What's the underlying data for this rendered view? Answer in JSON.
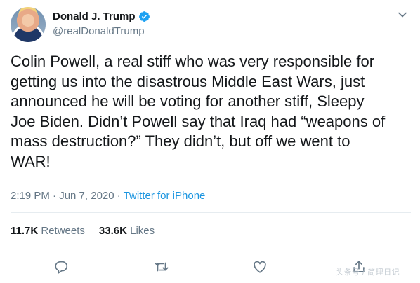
{
  "author": {
    "display_name": "Donald J. Trump",
    "handle": "@realDonaldTrump",
    "verified": true
  },
  "tweet": {
    "text": "Colin Powell, a real stiff who was very responsible for\ngetting us into the disastrous Middle East Wars, just\nannounced he will be voting for another stiff, Sleepy\nJoe Biden. Didn’t Powell say that Iraq had “weapons of\nmass destruction?” They didn’t, but off we went to\nWAR!",
    "time": "2:19 PM · Jun 7, 2020 · ",
    "source": "Twitter for iPhone"
  },
  "stats": {
    "retweets_count": "11.7K",
    "retweets_label": "Retweets",
    "likes_count": "33.6K",
    "likes_label": "Likes"
  },
  "icons": {
    "verified": "verified-badge-icon",
    "caret": "chevron-down-icon",
    "reply": "reply-icon",
    "retweet": "retweet-icon",
    "like": "heart-icon",
    "share": "share-icon"
  },
  "colors": {
    "text": "#14171a",
    "secondary": "#657786",
    "link": "#1b95e0",
    "verified": "#1da1f2"
  },
  "watermark": {
    "text": "头条号 / 简理日记"
  }
}
